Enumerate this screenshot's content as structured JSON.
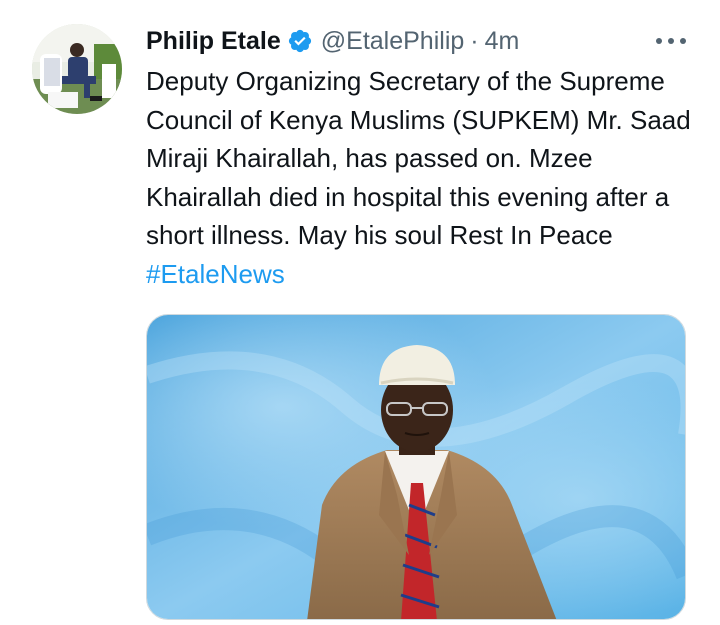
{
  "tweet": {
    "author": {
      "display_name": "Philip Etale",
      "handle": "@EtalePhilip",
      "verified": true
    },
    "separator": "·",
    "timestamp": "4m",
    "text_parts": {
      "main": "Deputy Organizing Secretary of the Supreme Council of Kenya Muslims (SUPKEM) Mr. Saad Miraji Khairallah, has passed on. Mzee Khairallah died in hospital this evening after a short illness. May his soul Rest In Peace ",
      "hashtag": "#EtaleNews"
    }
  },
  "colors": {
    "text": "#0f1419",
    "secondary": "#536471",
    "accent": "#1d9bf0",
    "media_border": "#cfd9de"
  },
  "icons": {
    "verified": "verified-badge-icon",
    "more": "more-options-icon"
  }
}
